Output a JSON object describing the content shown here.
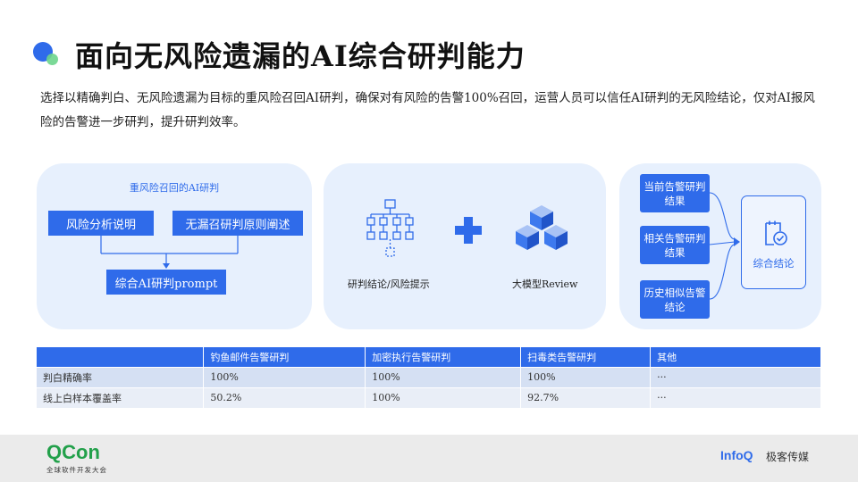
{
  "slide": {
    "title": "面向无风险遗漏的AI综合研判能力",
    "intro": "选择以精确判白、无风险遗漏为目标的重风险召回AI研判，确保对有风险的告警100%召回，运营人员可以信任AI研判的无风险结论，仅对AI报风险的告警进一步研判，提升研判效率。"
  },
  "panel_recall": {
    "title": "重风险召回的AI研判",
    "risk_box": "风险分析说明",
    "nomiss_box": "无漏召研判原则阐述",
    "combined_box": "综合AI研判prompt"
  },
  "panel_review": {
    "left_label": "研判结论/风险提示",
    "right_label": "大模型Review",
    "flow_icon": "flowchart-icon",
    "plus_icon": "plus-icon",
    "cubes_icon": "cubes-icon"
  },
  "panel_synthesis": {
    "current": "当前告警研判结果",
    "related": "相关告警研判结果",
    "history": "历史相似告警结论",
    "result": "综合结论",
    "result_icon": "clipboard-check-icon"
  },
  "table": {
    "headers": [
      "",
      "钓鱼邮件告警研判",
      "加密执行告警研判",
      "扫毒类告警研判",
      "其他"
    ],
    "rows": [
      [
        "判白精确率",
        "100%",
        "100%",
        "100%",
        "···"
      ],
      [
        "线上白样本覆盖率",
        "50.2%",
        "100%",
        "92.7%",
        "···"
      ]
    ]
  },
  "footer": {
    "qcon_logo": "QCon",
    "qcon_subtitle": "全球软件开发大会",
    "infoq_logo": "InfoQ",
    "geek_logo": "极客传媒"
  },
  "colors": {
    "accent": "#2f6bea",
    "panel_bg": "#e7f0fd",
    "qcon_green": "#22a04a"
  }
}
